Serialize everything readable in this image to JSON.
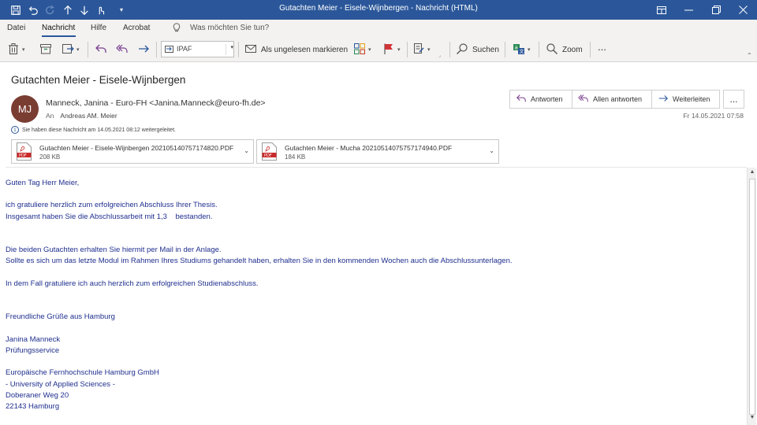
{
  "window": {
    "title": "Gutachten Meier - Eisele-Wijnbergen  -  Nachricht (HTML)",
    "accent": "#2b579a"
  },
  "menu": {
    "items": [
      "Datei",
      "Nachricht",
      "Hilfe",
      "Acrobat"
    ],
    "tell_me": "Was möchten Sie tun?"
  },
  "ribbon": {
    "folder": "IPAF",
    "mark_unread": "Als ungelesen markieren",
    "search": "Suchen",
    "zoom": "Zoom",
    "more": "..."
  },
  "message": {
    "subject": "Gutachten Meier - Eisele-Wijnbergen",
    "avatar_initials": "MJ",
    "sender": "Manneck, Janina - Euro-FH <Janina.Manneck@euro-fh.de>",
    "to_label": "An",
    "to": "Andreas AM. Meier",
    "date": "Fr 14.05.2021 07:58",
    "info": "Sie haben diese Nachricht am 14.05.2021 08:12 weitergeleitet.",
    "actions": {
      "reply": "Antworten",
      "reply_all": "Allen antworten",
      "forward": "Weiterleiten",
      "more": "..."
    },
    "attachments": [
      {
        "name": "Gutachten Meier - Eisele-Wijnbergen 20210514075717482​0.PDF",
        "size": "208 KB"
      },
      {
        "name": "Gutachten Meier - Mucha 2021051407575717494​0.PDF",
        "size": "184 KB"
      }
    ],
    "body": [
      "Guten Tag Herr Meier,",
      "",
      "ich gratuliere herzlich zum erfolgreichen Abschluss Ihrer Thesis.",
      "Insgesamt haben Sie die Abschlussarbeit mit 1,3    bestanden.",
      "",
      "",
      "Die beiden Gutachten erhalten Sie hiermit per Mail in der Anlage.",
      "Sollte es sich um das letzte Modul im Rahmen Ihres Studiums gehandelt haben, erhalten Sie in den kommenden Wochen auch die Abschlussunterlagen.",
      "",
      "In dem Fall gratuliere ich auch herzlich zum erfolgreichen Studienabschluss.",
      "",
      "",
      "Freundliche Grüße aus Hamburg",
      "",
      "Janina Manneck",
      "Prüfungsservice",
      "",
      "Europäische Fernhochschule Hamburg GmbH",
      "- University of Applied Sciences -",
      "Doberaner Weg 20",
      "22143 Hamburg"
    ]
  }
}
